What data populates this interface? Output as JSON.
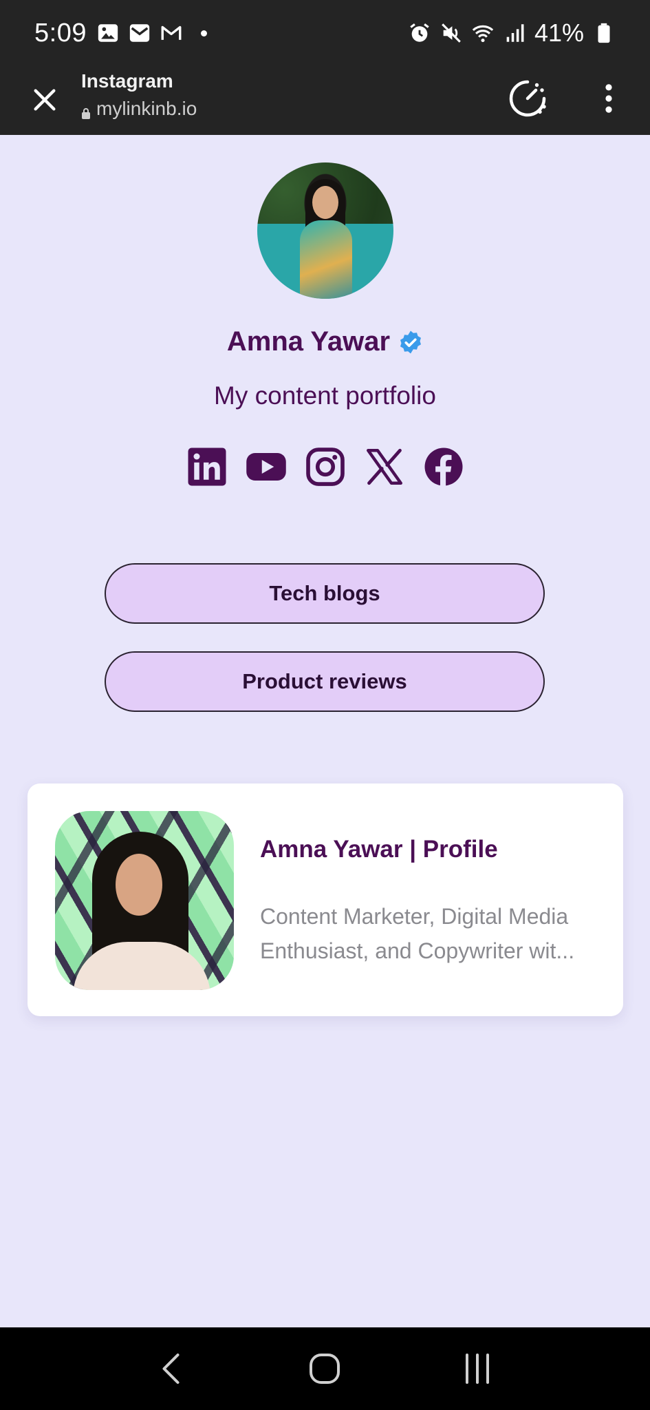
{
  "status_bar": {
    "time": "5:09",
    "battery": "41%",
    "left_icons": [
      "gallery-icon",
      "email-icon",
      "gmail-icon"
    ],
    "right_icons": [
      "alarm-icon",
      "mute-icon",
      "wifi-icon",
      "signal-icon",
      "battery-icon"
    ]
  },
  "browser": {
    "title": "Instagram",
    "url": "mylinkinb.io"
  },
  "profile": {
    "name": "Amna Yawar",
    "tagline": "My content portfolio"
  },
  "socials": [
    {
      "icon": "linkedin-icon"
    },
    {
      "icon": "youtube-icon"
    },
    {
      "icon": "instagram-icon"
    },
    {
      "icon": "x-icon"
    },
    {
      "icon": "facebook-icon"
    }
  ],
  "links": [
    {
      "label": "Tech blogs"
    },
    {
      "label": "Product reviews"
    }
  ],
  "card": {
    "title": "Amna Yawar | Profile",
    "desc_line1": "Content Marketer, Digital Media",
    "desc_line2": "Enthusiast, and Copywriter wit..."
  },
  "colors": {
    "background": "#e8e6fa",
    "accent": "#4b0f55",
    "button": "#e3cdf8"
  }
}
